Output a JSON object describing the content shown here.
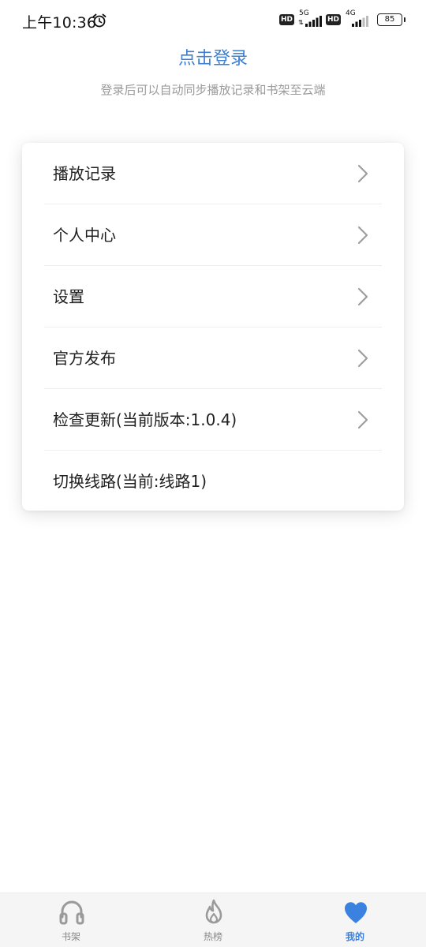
{
  "status_bar": {
    "time": "上午10:36",
    "hd1": "HD",
    "net1": "5G",
    "hd2": "HD",
    "net2": "4G",
    "battery": "85"
  },
  "header": {
    "login_link": "点击登录",
    "login_hint": "登录后可以自动同步播放记录和书架至云端"
  },
  "menu": {
    "items": [
      {
        "label": "播放记录"
      },
      {
        "label": "个人中心"
      },
      {
        "label": "设置"
      },
      {
        "label": "官方发布"
      },
      {
        "label": "检查更新(当前版本:1.0.4)"
      },
      {
        "label": "切换线路(当前:线路1)"
      }
    ]
  },
  "bottom_nav": {
    "items": [
      {
        "label": "书架",
        "icon": "headphones-icon"
      },
      {
        "label": "热榜",
        "icon": "flame-icon"
      },
      {
        "label": "我的",
        "icon": "heart-icon"
      }
    ],
    "active": "我的",
    "active_color": "#3b82e0",
    "inactive_color": "#8a8a8a"
  },
  "colors": {
    "accent": "#3c7fd3"
  }
}
